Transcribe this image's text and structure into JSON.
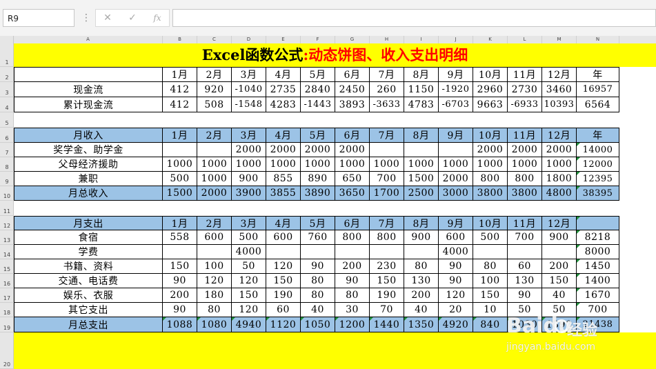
{
  "formula_bar": {
    "name_box": "R9",
    "cancel_icon": "✕",
    "enter_icon": "✓",
    "fx_label": "fx",
    "formula": ""
  },
  "columns": [
    "A",
    "B",
    "C",
    "D",
    "E",
    "F",
    "G",
    "H",
    "I",
    "J",
    "K",
    "L",
    "M",
    "N"
  ],
  "row_numbers": [
    "1",
    "2",
    "3",
    "4",
    "5",
    "6",
    "7",
    "8",
    "9",
    "10",
    "11",
    "12",
    "13",
    "14",
    "15",
    "16",
    "17",
    "18",
    "19",
    "20"
  ],
  "title": {
    "part1": "Excel函数公式",
    "part2": ":动态饼图、收入支出明细"
  },
  "cashflow": {
    "header": [
      "",
      "1月",
      "2月",
      "3月",
      "4月",
      "5月",
      "6月",
      "7月",
      "8月",
      "9月",
      "10月",
      "11月",
      "12月",
      "年"
    ],
    "rows": [
      [
        "现金流",
        "412",
        "920",
        "-1040",
        "2735",
        "2840",
        "2450",
        "260",
        "1150",
        "-1920",
        "2960",
        "2730",
        "3460",
        "16957"
      ],
      [
        "累计现金流",
        "412",
        "508",
        "-1548",
        "4283",
        "-1443",
        "3893",
        "-3633",
        "4783",
        "-6703",
        "9663",
        "-6933",
        "10393",
        "6564"
      ]
    ]
  },
  "income": {
    "header": [
      "月收入",
      "1月",
      "2月",
      "3月",
      "4月",
      "5月",
      "6月",
      "7月",
      "8月",
      "9月",
      "10月",
      "11月",
      "12月",
      "年"
    ],
    "rows": [
      [
        "奖学金、助学金",
        "",
        "",
        "2000",
        "2000",
        "2000",
        "2000",
        "",
        "",
        "",
        "2000",
        "2000",
        "2000",
        "14000"
      ],
      [
        "父母经济援助",
        "1000",
        "1000",
        "1000",
        "1000",
        "1000",
        "1000",
        "1000",
        "1000",
        "1000",
        "1000",
        "1000",
        "1000",
        "12000"
      ],
      [
        "兼职",
        "500",
        "1000",
        "900",
        "855",
        "890",
        "650",
        "700",
        "1500",
        "2000",
        "800",
        "800",
        "1800",
        "12395"
      ]
    ],
    "total": [
      "月总收入",
      "1500",
      "2000",
      "3900",
      "3855",
      "3890",
      "3650",
      "1700",
      "2500",
      "3000",
      "3800",
      "3800",
      "4800",
      "38395"
    ]
  },
  "expense": {
    "header": [
      "月支出",
      "1月",
      "2月",
      "3月",
      "4月",
      "5月",
      "6月",
      "7月",
      "8月",
      "9月",
      "10月",
      "11月",
      "12月",
      ""
    ],
    "rows": [
      [
        "食宿",
        "558",
        "600",
        "500",
        "600",
        "760",
        "800",
        "800",
        "900",
        "600",
        "500",
        "700",
        "900",
        "8218"
      ],
      [
        "学费",
        "",
        "",
        "4000",
        "",
        "",
        "",
        "",
        "",
        "4000",
        "",
        "",
        "",
        "8000"
      ],
      [
        "书籍、资料",
        "150",
        "100",
        "50",
        "120",
        "90",
        "200",
        "230",
        "80",
        "90",
        "80",
        "60",
        "200",
        "1450"
      ],
      [
        "交通、电话费",
        "90",
        "120",
        "120",
        "150",
        "80",
        "90",
        "150",
        "130",
        "90",
        "100",
        "130",
        "150",
        "1400"
      ],
      [
        "娱乐、衣服",
        "200",
        "180",
        "150",
        "190",
        "80",
        "80",
        "190",
        "200",
        "120",
        "150",
        "90",
        "40",
        "1670"
      ],
      [
        "其它支出",
        "90",
        "80",
        "120",
        "60",
        "40",
        "30",
        "70",
        "40",
        "20",
        "10",
        "50",
        "50",
        "700"
      ]
    ],
    "total": [
      "月总支出",
      "1088",
      "1080",
      "4940",
      "1120",
      "1050",
      "1200",
      "1440",
      "1350",
      "4920",
      "840",
      "1030",
      "1390",
      "21438"
    ]
  },
  "watermark": {
    "brand": "Baidu",
    "product": "经验",
    "url": "jingyan.baidu.com"
  },
  "colors": {
    "title_bg": "#ffff00",
    "header_bg": "#9cc3e6",
    "title_accent": "#ff0000",
    "flag": "#1f8f3a"
  }
}
